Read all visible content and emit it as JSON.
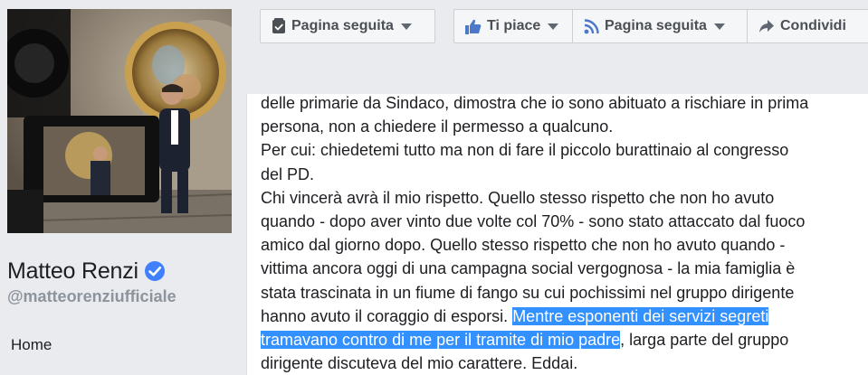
{
  "profile": {
    "name": "Matteo Renzi",
    "handle": "@matteorenziufficiale",
    "verified_color": "#4080ff"
  },
  "nav": {
    "home_label": "Home"
  },
  "toolbar": {
    "followed_left_label": "Pagina seguita",
    "like_label": "Ti piace",
    "followed_label": "Pagina seguita",
    "share_label": "Condividi"
  },
  "post": {
    "lines": [
      "delle primarie da Sindaco, dimostra che io sono abituato a rischiare in prima",
      "persona, non a chiedere il permesso a qualcuno.",
      "Per cui: chiedetemi tutto ma non di fare il piccolo burattinaio al congresso",
      "del PD.",
      "Chi vincerà avrà il mio rispetto. Quello stesso rispetto che non ho avuto",
      "quando - dopo aver vinto due volte col 70% - sono stato attaccato dal fuoco",
      "amico dal giorno dopo. Quello stesso rispetto che non ho avuto quando -",
      "vittima ancora oggi di una campagna social vergognosa - la mia famiglia è",
      "stata trascinata in un fiume di fango su cui pochissimi nel gruppo dirigente"
    ],
    "line9_plain": "hanno avuto il coraggio di esporsi. ",
    "line9_highlight": "Mentre esponenti dei servizi segreti",
    "line10_highlight": "tramavano contro di me per il tramite di mio padre",
    "line10_plain": ", larga parte del gruppo",
    "line11": "dirigente discuteva del mio carattere. Eddai.",
    "highlight_color": "#3390ff"
  }
}
